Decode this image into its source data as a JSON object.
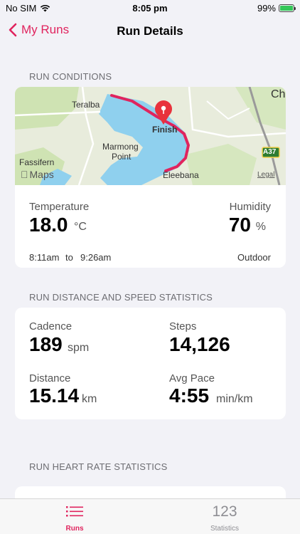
{
  "status_bar": {
    "carrier": "No SIM",
    "time": "8:05 pm",
    "battery": "99%",
    "battery_level": 0.99
  },
  "nav": {
    "back_label": "My Runs",
    "title": "Run Details"
  },
  "conditions": {
    "header": "RUN CONDITIONS",
    "map": {
      "labels": {
        "teralba": "Teralba",
        "finish": "Finish",
        "marmong": "Marmong",
        "point": "Point",
        "fassifern": "Fassifern",
        "eleebana": "Eleebana",
        "apple_maps": "Maps",
        "legal": "Legal",
        "road_badge": "A37",
        "ch": "Ch"
      }
    },
    "temperature_label": "Temperature",
    "temperature_value": "18.0",
    "temperature_unit": "°C",
    "humidity_label": "Humidity",
    "humidity_value": "70",
    "humidity_unit": "%",
    "start_time": "8:11am",
    "to": "to",
    "end_time": "9:26am",
    "location_type": "Outdoor"
  },
  "distance_speed": {
    "header": "RUN DISTANCE AND SPEED STATISTICS",
    "cadence_label": "Cadence",
    "cadence_value": "189",
    "cadence_unit": "spm",
    "steps_label": "Steps",
    "steps_value": "14,126",
    "distance_label": "Distance",
    "distance_value": "15.14",
    "distance_unit": "km",
    "pace_label": "Avg Pace",
    "pace_value": "4:55",
    "pace_unit": "min/km"
  },
  "heart_rate": {
    "header": "RUN HEART RATE STATISTICS"
  },
  "tabs": [
    {
      "label": "Runs",
      "icon": "list-icon",
      "active": true
    },
    {
      "label": "Statistics",
      "icon_text": "123",
      "active": false
    }
  ],
  "colors": {
    "accent": "#e0245e",
    "water": "#8fd0ee",
    "route": "#e0245e"
  }
}
